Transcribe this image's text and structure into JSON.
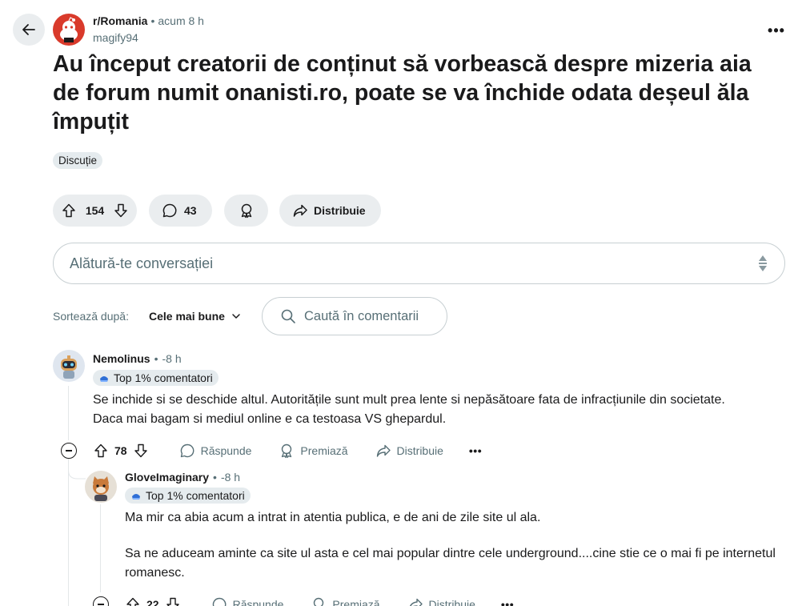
{
  "header": {
    "subreddit": "r/Romania",
    "separator": "•",
    "time": "acum 8 h",
    "author": "magify94",
    "more": "•••"
  },
  "post": {
    "title": "Au început creatorii de conținut să vorbească despre mizeria aia de forum numit onanisti.ro, poate se va închide odata deșeul ăla împuțit",
    "flair": "Discuție"
  },
  "actions": {
    "score": "154",
    "comments": "43",
    "share_label": "Distribuie"
  },
  "join": {
    "placeholder": "Alătură-te conversației"
  },
  "sort": {
    "label": "Sortează după:",
    "value": "Cele mai bune"
  },
  "search": {
    "placeholder": "Caută în comentarii"
  },
  "comments": [
    {
      "author": "Nemolinus",
      "separator": "•",
      "time": "-8 h",
      "badge": "Top 1% comentatori",
      "body": [
        "Se inchide si se deschide altul. Autoritățile sunt mult prea lente si nepăsătoare fata de infracțiunile din societate. Daca mai bagam si mediul online e ca testoasa VS ghepardul."
      ],
      "score": "78",
      "reply": "Răspunde",
      "award": "Premiază",
      "share": "Distribuie",
      "more": "•••"
    },
    {
      "author": "GloveImaginary",
      "separator": "•",
      "time": "-8 h",
      "badge": "Top 1% comentatori",
      "body": [
        "Ma mir ca abia acum a intrat in atentia publica, e de ani de zile site ul ala.",
        "Sa ne aduceam aminte ca site ul asta e cel mai popular dintre cele underground....cine stie ce o mai fi pe internetul romanesc."
      ],
      "score": "22",
      "reply": "Răspunde",
      "award": "Premiază",
      "share": "Distribuie",
      "more": "•••"
    }
  ],
  "colors": {
    "subreddit_avatar": "#d93a2b",
    "pill_bg": "#eaedef",
    "muted_text": "#576f76"
  }
}
